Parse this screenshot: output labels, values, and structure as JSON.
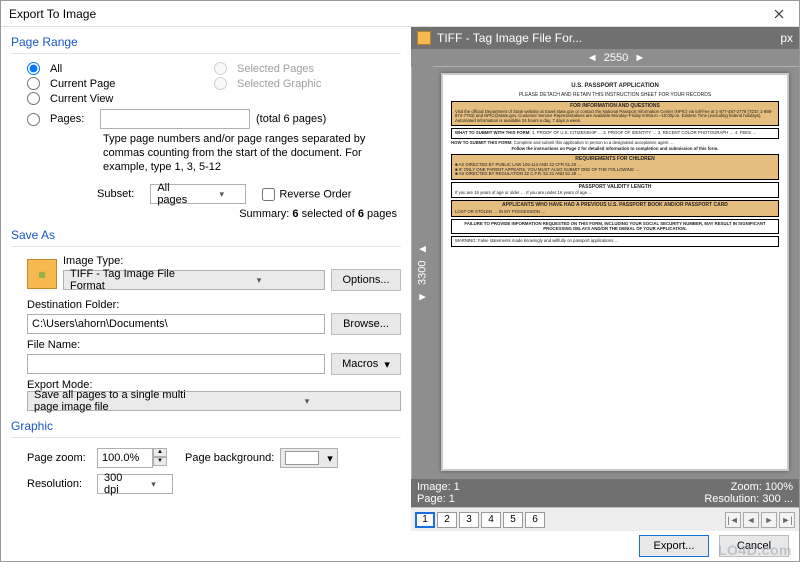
{
  "window": {
    "title": "Export To Image"
  },
  "page_range": {
    "title": "Page Range",
    "all": "All",
    "current_page": "Current Page",
    "current_view": "Current View",
    "pages": "Pages:",
    "selected_pages": "Selected Pages",
    "selected_graphic": "Selected Graphic",
    "total": "(total 6 pages)",
    "hint": "Type page numbers and/or page ranges separated by commas counting from the start of the document. For example, type 1, 3, 5-12",
    "subset_label": "Subset:",
    "subset_value": "All pages",
    "reverse_order": "Reverse Order",
    "summary_pre": "Summary: ",
    "summary_count": "6",
    "summary_mid": " selected of ",
    "summary_total": "6",
    "summary_post": " pages"
  },
  "save_as": {
    "title": "Save As",
    "image_type_label": "Image Type:",
    "image_type_value": "TIFF - Tag Image File Format",
    "options": "Options...",
    "dest_label": "Destination Folder:",
    "dest_value": "C:\\Users\\ahorn\\Documents\\",
    "browse": "Browse...",
    "file_label": "File Name:",
    "file_value": "",
    "macros": "Macros",
    "export_mode_label": "Export Mode:",
    "export_mode_value": "Save all pages to a single multi page image file"
  },
  "graphic": {
    "title": "Graphic",
    "zoom_label": "Page zoom:",
    "zoom_value": "100.0%",
    "res_label": "Resolution:",
    "res_value": "300 dpi",
    "bg_label": "Page background:"
  },
  "preview": {
    "header_title": "TIFF - Tag Image File For...",
    "px": "px",
    "hruler": "2550",
    "vruler": "3300",
    "status_image": "Image: 1",
    "status_page": "Page: 1",
    "status_zoom": "Zoom: 100%",
    "status_res": "Resolution: 300 ...",
    "thumbs": [
      "1",
      "2",
      "3",
      "4",
      "5",
      "6"
    ]
  },
  "doc": {
    "title": "U.S. PASSPORT APPLICATION",
    "detach": "PLEASE DETACH AND RETAIN THIS INSTRUCTION SHEET FOR YOUR RECORDS",
    "info_title": "FOR INFORMATION AND QUESTIONS",
    "info_body": "Visit the official Department of State website at travel.state.gov or contact the National Passport Information Center (NPIC) via toll-free at 1-877-487-2778 (TDD: 1-888-874-7793) and NPIC@state.gov. Customer Service Representatives are available Monday–Friday 8:00a.m.–10:00p.m. Eastern Time (excluding federal holidays). Automated information is available 24 hours a day, 7 days a week.",
    "how_title": "HOW TO SUBMIT THIS FORM:",
    "follow": "Follow the instructions on Page 2 for detailed information to completion and submission of this form.",
    "req_children": "REQUIREMENTS FOR CHILDREN",
    "validity": "PASSPORT VALIDITY LENGTH",
    "prev": "APPLICANTS WHO HAVE HAD A PREVIOUS U.S. PASSPORT BOOK AND/OR PASSPORT CARD",
    "failure": "FAILURE TO PROVIDE INFORMATION REQUESTED ON THIS FORM, INCLUDING YOUR SOCIAL SECURITY NUMBER, MAY RESULT IN SIGNIFICANT PROCESSING DELAYS AND/OR THE DENIAL OF YOUR APPLICATION."
  },
  "footer": {
    "export": "Export...",
    "cancel": "Cancel"
  },
  "watermark": "LO4D.com"
}
